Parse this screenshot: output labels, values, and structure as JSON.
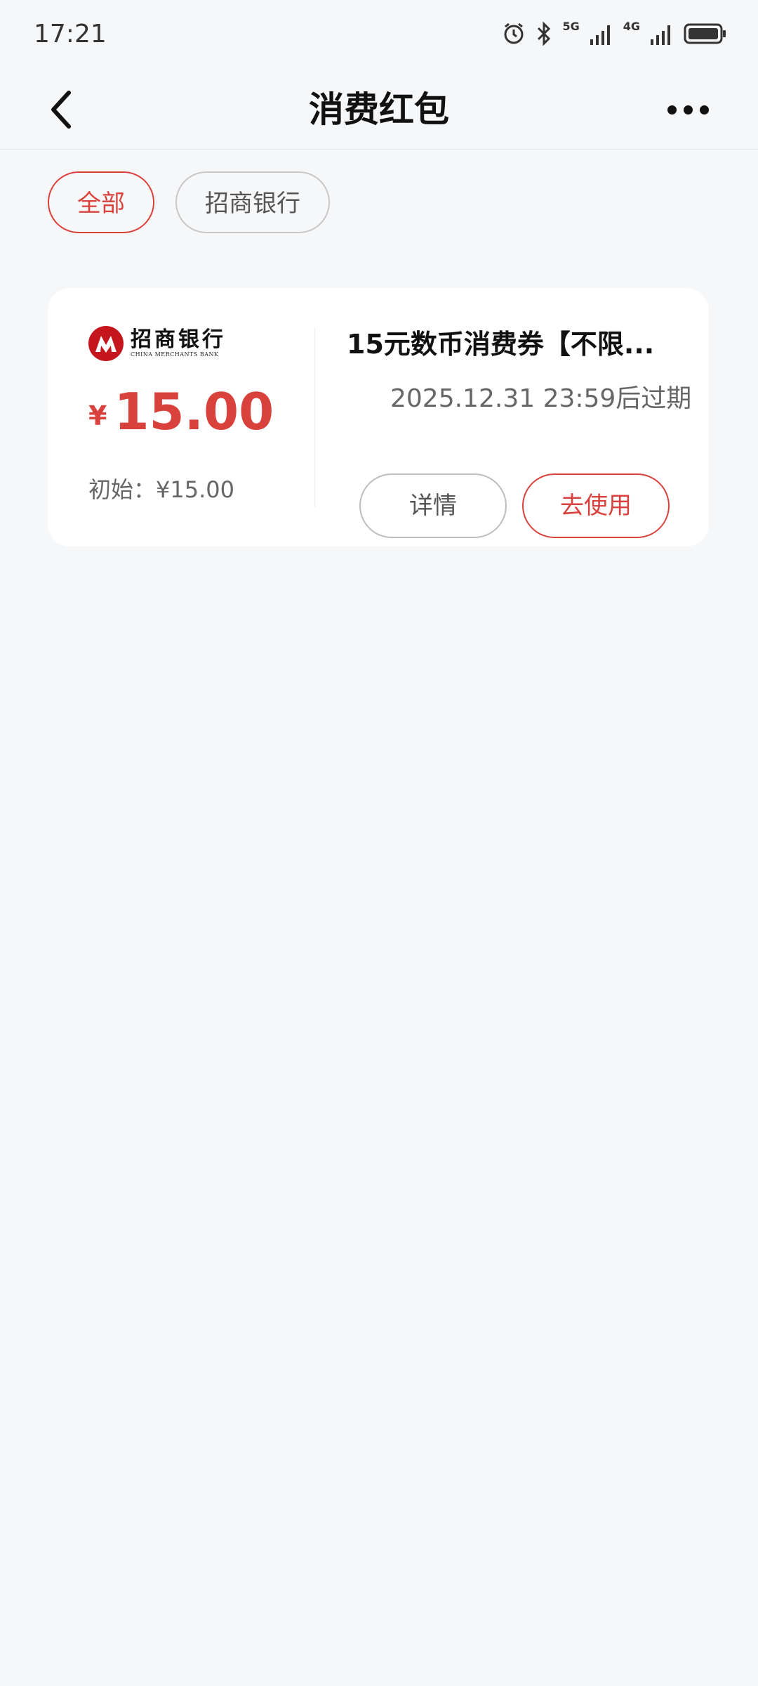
{
  "status_bar": {
    "time": "17:21",
    "net1_label": "5G",
    "net2_label": "4G",
    "icons": [
      "alarm-icon",
      "bluetooth-icon",
      "signal-5g-icon",
      "signal-4g-icon",
      "battery-icon"
    ]
  },
  "header": {
    "title": "消费红包",
    "back_icon": "chevron-left-icon",
    "more_icon": "more-dots-icon"
  },
  "filters": {
    "all": "全部",
    "cmb": "招商银行",
    "selected": "全部"
  },
  "coupon": {
    "bank_name": "招商银行",
    "bank_name_en": "CHINA MERCHANTS BANK",
    "currency": "¥",
    "amount": "15.00",
    "initial": "初始：¥15.00",
    "title": "15元数币消费券【不限...",
    "expiry": "2025.12.31 23:59后过期",
    "details_label": "详情",
    "use_label": "去使用"
  },
  "colors": {
    "accent": "#d8413c",
    "brand": "#c4161c",
    "background": "#f6f7f9"
  }
}
